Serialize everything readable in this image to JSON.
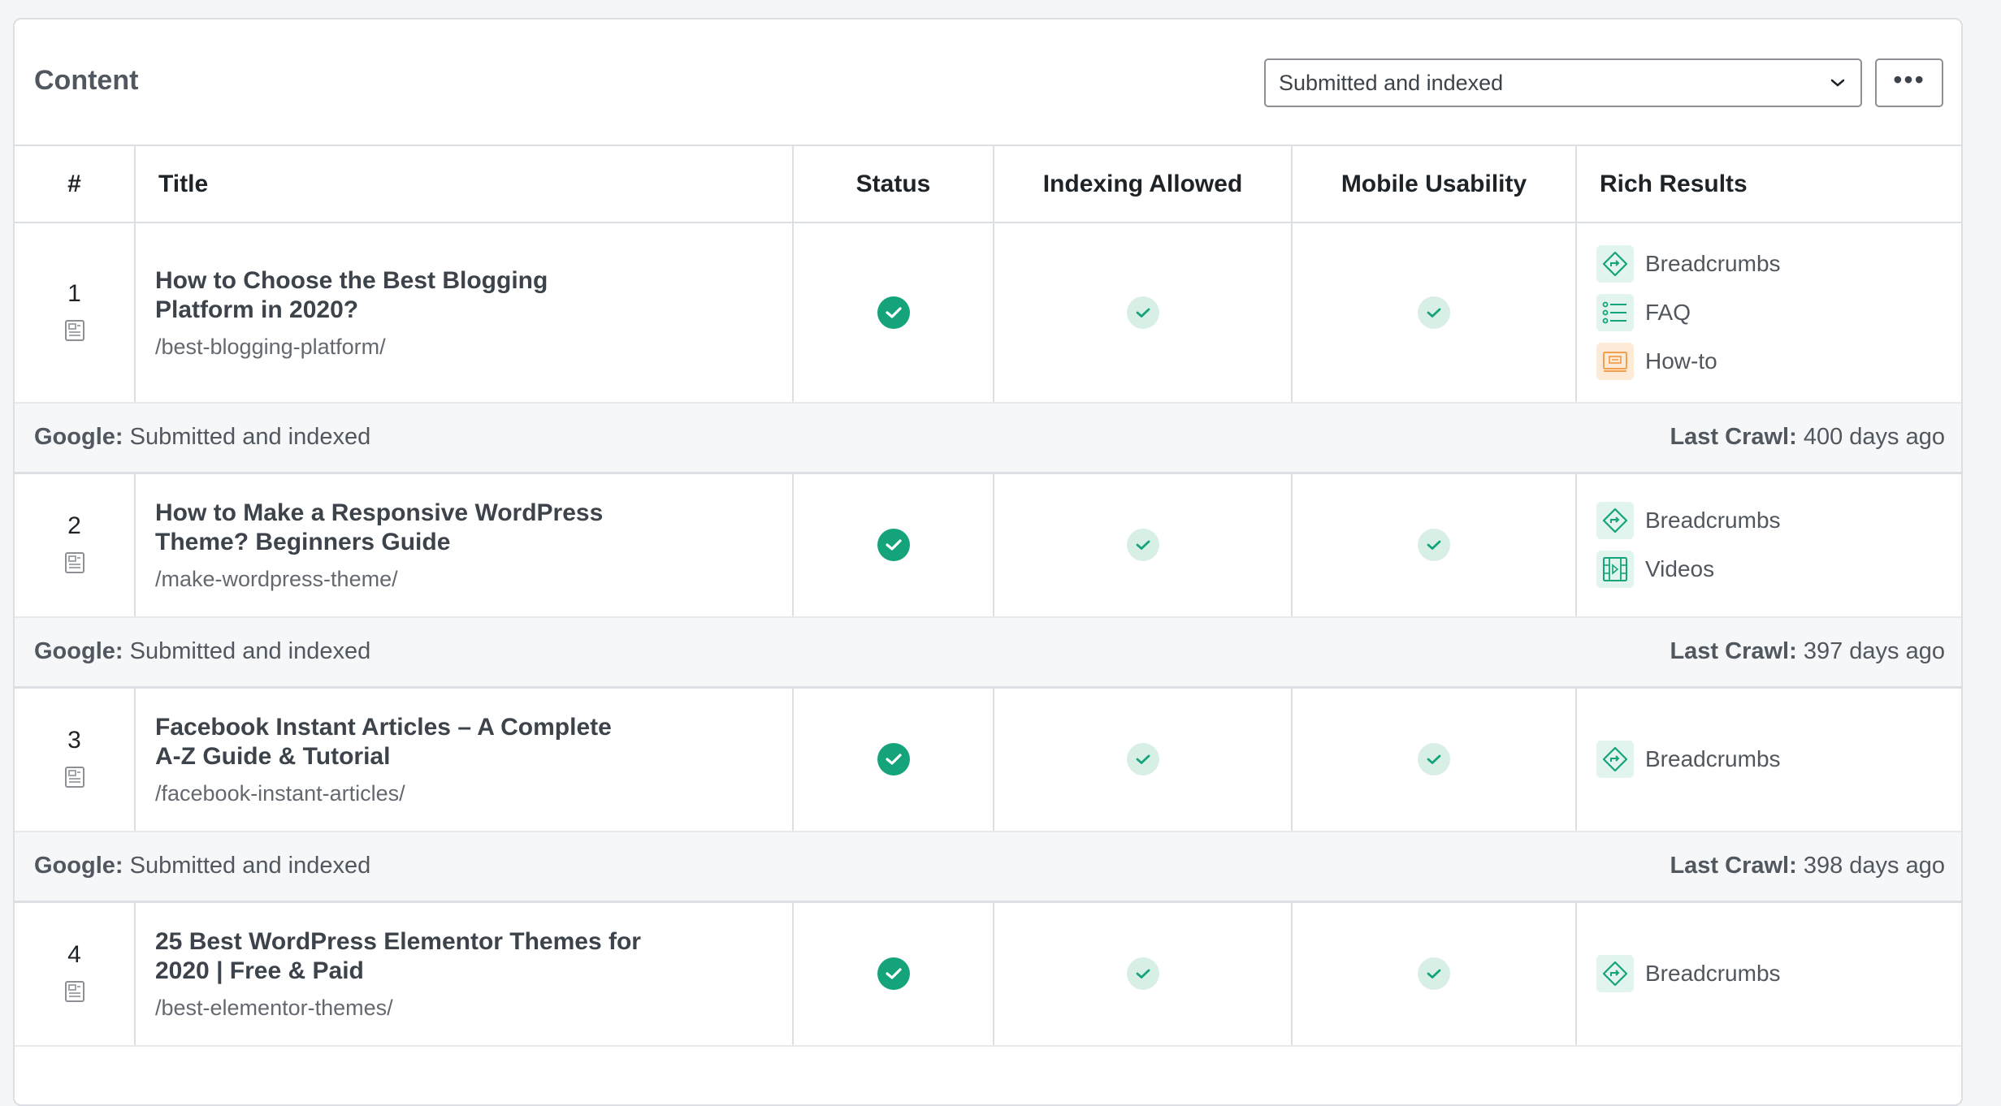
{
  "header": {
    "title": "Content",
    "filter_value": "Submitted and indexed",
    "more_label": "•••"
  },
  "columns": {
    "num": "#",
    "title": "Title",
    "status": "Status",
    "indexing": "Indexing Allowed",
    "mobile": "Mobile Usability",
    "rich": "Rich Results"
  },
  "rows": [
    {
      "num": "1",
      "title": "How to Choose the Best Blogging Platform in 2020?",
      "slug": "/best-blogging-platform/",
      "rich": [
        "Breadcrumbs",
        "FAQ",
        "How-to"
      ],
      "google_label": "Google:",
      "google_status": "Submitted and indexed",
      "crawl_label": "Last Crawl:",
      "crawl_value": "400 days ago"
    },
    {
      "num": "2",
      "title": "How to Make a Responsive WordPress Theme? Beginners Guide",
      "slug": "/make-wordpress-theme/",
      "rich": [
        "Breadcrumbs",
        "Videos"
      ],
      "google_label": "Google:",
      "google_status": "Submitted and indexed",
      "crawl_label": "Last Crawl:",
      "crawl_value": "397 days ago"
    },
    {
      "num": "3",
      "title": "Facebook Instant Articles – A Complete A-Z Guide & Tutorial",
      "slug": "/facebook-instant-articles/",
      "rich": [
        "Breadcrumbs"
      ],
      "google_label": "Google:",
      "google_status": "Submitted and indexed",
      "crawl_label": "Last Crawl:",
      "crawl_value": "398 days ago"
    },
    {
      "num": "4",
      "title": "25 Best WordPress Elementor Themes for 2020 | Free & Paid",
      "slug": "/best-elementor-themes/",
      "rich": [
        "Breadcrumbs"
      ]
    }
  ],
  "colors": {
    "check_solid": "#14a37a",
    "check_light": "#d8efe6",
    "rich_green": "#14a37a",
    "rich_orange": "#f0a050"
  },
  "icons": {
    "breadcrumbs": "breadcrumbs-icon",
    "faq": "faq-icon",
    "howto": "howto-icon",
    "videos": "videos-icon",
    "page": "page-icon",
    "check": "check-icon",
    "chevron": "chevron-down-icon"
  }
}
